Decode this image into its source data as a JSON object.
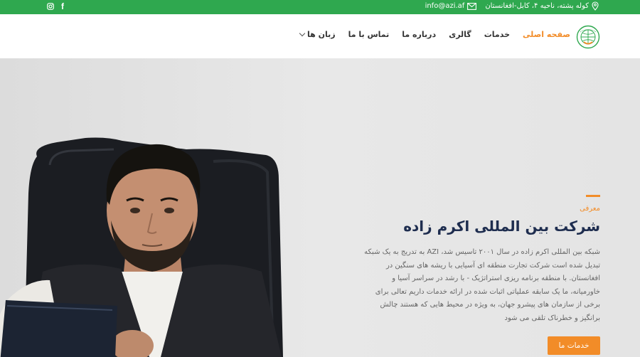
{
  "topbar": {
    "address": "کوله پشته، ناحیه ۴، کابل-افغانستان",
    "email": "info@azi.af",
    "social": [
      "instagram-icon",
      "facebook-icon"
    ]
  },
  "nav": {
    "items": [
      {
        "label": "صفحه اصلی",
        "active": true
      },
      {
        "label": "خدمات",
        "active": false
      },
      {
        "label": "گالری",
        "active": false
      },
      {
        "label": "درباره ما",
        "active": false
      },
      {
        "label": "تماس با ما",
        "active": false
      },
      {
        "label": "زبان ها",
        "active": false,
        "dropdown": true
      }
    ]
  },
  "hero": {
    "eyebrow": "معرفی",
    "title": "شرکت بین المللی اکرم زاده",
    "description": "شبکه بین المللی اکرم زاده در سال ۲۰۰۱ تاسیس شد، AZI به تدریج به یک شبکه تبدیل شده است شرکت تجارت منطقه ای آسیایی با ریشه های سنگین در افغانستان. با منطقه برنامه ریزی استراتژیک - با رشد در سراسر آسیا و خاورمیانه، ما یک سابقه عملیاتی اثبات شده در ارائه خدمات داریم تعالی برای برخی از سازمان های پیشرو جهان، به ویژه در محیط هایی که هستند چالش برانگیز و خطرناک تلقی می شود",
    "cta_label": "خدمات ما"
  },
  "colors": {
    "topbar_green": "#2fa84f",
    "accent_orange": "#f28c28",
    "title_navy": "#1e2d4f"
  }
}
